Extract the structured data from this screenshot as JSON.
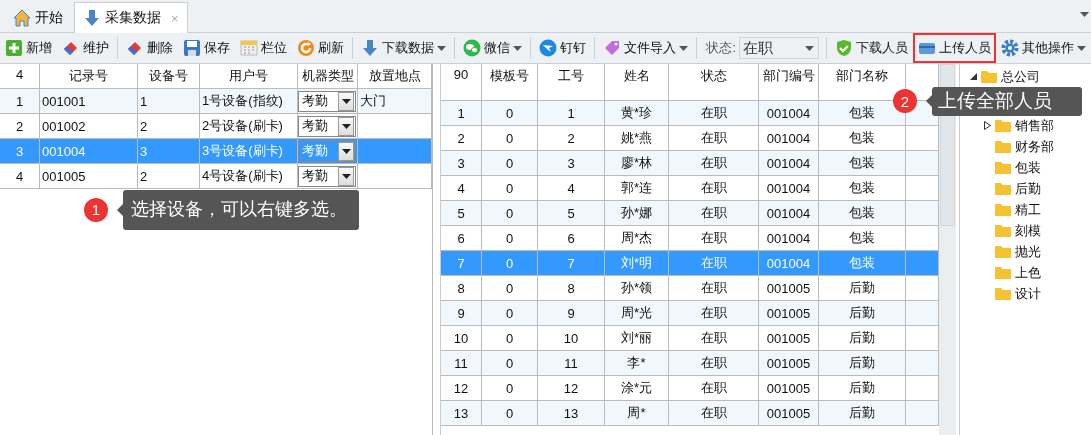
{
  "tabs": [
    {
      "label": "开始",
      "selected": false
    },
    {
      "label": "采集数据",
      "selected": true,
      "close": "×"
    }
  ],
  "toolbar": [
    {
      "kind": "button",
      "label": "新增",
      "dropdown": false,
      "highlighted": false
    },
    {
      "kind": "button",
      "label": "维护",
      "dropdown": false,
      "highlighted": false
    },
    {
      "kind": "separator"
    },
    {
      "kind": "button",
      "label": "删除",
      "dropdown": false,
      "highlighted": false
    },
    {
      "kind": "button",
      "label": "保存",
      "dropdown": false,
      "highlighted": false
    },
    {
      "kind": "button",
      "label": "栏位",
      "dropdown": false,
      "highlighted": false
    },
    {
      "kind": "button",
      "label": "刷新",
      "dropdown": false,
      "highlighted": false
    },
    {
      "kind": "separator"
    },
    {
      "kind": "button",
      "label": "下载数据",
      "dropdown": true,
      "highlighted": false
    },
    {
      "kind": "separator"
    },
    {
      "kind": "button",
      "label": "微信",
      "dropdown": true,
      "highlighted": false
    },
    {
      "kind": "separator"
    },
    {
      "kind": "button",
      "label": "钉钉",
      "dropdown": false,
      "highlighted": false
    },
    {
      "kind": "separator"
    },
    {
      "kind": "button",
      "label": "文件导入",
      "dropdown": true,
      "highlighted": false
    },
    {
      "kind": "separator"
    },
    {
      "kind": "spacer"
    },
    {
      "kind": "select",
      "label": "状态:",
      "value": "在职"
    },
    {
      "kind": "separator"
    },
    {
      "kind": "button",
      "label": "下载人员",
      "dropdown": false,
      "highlighted": false
    },
    {
      "kind": "button",
      "label": "上传人员",
      "dropdown": false,
      "highlighted": true
    },
    {
      "kind": "button",
      "label": "其他操作",
      "dropdown": true,
      "highlighted": false
    }
  ],
  "device_table": {
    "count": "4",
    "columns": [
      "记录号",
      "设备号",
      "用户号",
      "机器类型",
      "放置地点"
    ],
    "rows": [
      {
        "index": "1",
        "record": "001001",
        "device": "1",
        "user": "1号设备(指纹)",
        "machine_type": "考勤",
        "location": "大门",
        "selected": false
      },
      {
        "index": "2",
        "record": "001002",
        "device": "2",
        "user": "2号设备(刷卡)",
        "machine_type": "考勤",
        "location": "",
        "selected": false
      },
      {
        "index": "3",
        "record": "001004",
        "device": "3",
        "user": "3号设备(刷卡)",
        "machine_type": "考勤",
        "location": "",
        "selected": true
      },
      {
        "index": "4",
        "record": "001005",
        "device": "2",
        "user": "4号设备(刷卡)",
        "machine_type": "考勤",
        "location": "",
        "selected": false
      }
    ]
  },
  "staff_table": {
    "columns": [
      "90",
      "模板号",
      "工号",
      "姓名",
      "状态",
      "部门编号",
      "部门名称"
    ],
    "rows": [
      {
        "cells": [
          "1",
          "0",
          "1",
          "黄*珍",
          "在职",
          "001004",
          "包装"
        ],
        "selected": false
      },
      {
        "cells": [
          "2",
          "0",
          "2",
          "姚*燕",
          "在职",
          "001004",
          "包装"
        ],
        "selected": false
      },
      {
        "cells": [
          "3",
          "0",
          "3",
          "廖*林",
          "在职",
          "001004",
          "包装"
        ],
        "selected": false
      },
      {
        "cells": [
          "4",
          "0",
          "4",
          "郭*连",
          "在职",
          "001004",
          "包装"
        ],
        "selected": false
      },
      {
        "cells": [
          "5",
          "0",
          "5",
          "孙*娜",
          "在职",
          "001004",
          "包装"
        ],
        "selected": false
      },
      {
        "cells": [
          "6",
          "0",
          "6",
          "周*杰",
          "在职",
          "001004",
          "包装"
        ],
        "selected": false
      },
      {
        "cells": [
          "7",
          "0",
          "7",
          "刘*明",
          "在职",
          "001004",
          "包装"
        ],
        "selected": true
      },
      {
        "cells": [
          "8",
          "0",
          "8",
          "孙*领",
          "在职",
          "001005",
          "后勤"
        ],
        "selected": false
      },
      {
        "cells": [
          "9",
          "0",
          "9",
          "周*光",
          "在职",
          "001005",
          "后勤"
        ],
        "selected": false
      },
      {
        "cells": [
          "10",
          "0",
          "10",
          "刘*丽",
          "在职",
          "001005",
          "后勤"
        ],
        "selected": false
      },
      {
        "cells": [
          "11",
          "0",
          "11",
          "李*",
          "在职",
          "001005",
          "后勤"
        ],
        "selected": false
      },
      {
        "cells": [
          "12",
          "0",
          "12",
          "涂*元",
          "在职",
          "001005",
          "后勤"
        ],
        "selected": false
      },
      {
        "cells": [
          "13",
          "0",
          "13",
          "周*",
          "在职",
          "001005",
          "后勤"
        ],
        "selected": false
      }
    ]
  },
  "department_tree": {
    "label": "总公司",
    "expanded": true,
    "children": [
      {
        "label": "销售部",
        "kind": "branch",
        "expanded": false
      },
      {
        "label": "财务部",
        "kind": "leaf"
      },
      {
        "label": "包装",
        "kind": "leaf"
      },
      {
        "label": "后勤",
        "kind": "leaf"
      },
      {
        "label": "精工",
        "kind": "leaf"
      },
      {
        "label": "刻模",
        "kind": "leaf"
      },
      {
        "label": "抛光",
        "kind": "leaf"
      },
      {
        "label": "上色",
        "kind": "leaf"
      },
      {
        "label": "设计",
        "kind": "leaf"
      }
    ]
  },
  "callouts": [
    {
      "number": "1",
      "text": "选择设备，可以右键多选。"
    },
    {
      "number": "2",
      "text": "上传全部人员"
    }
  ]
}
